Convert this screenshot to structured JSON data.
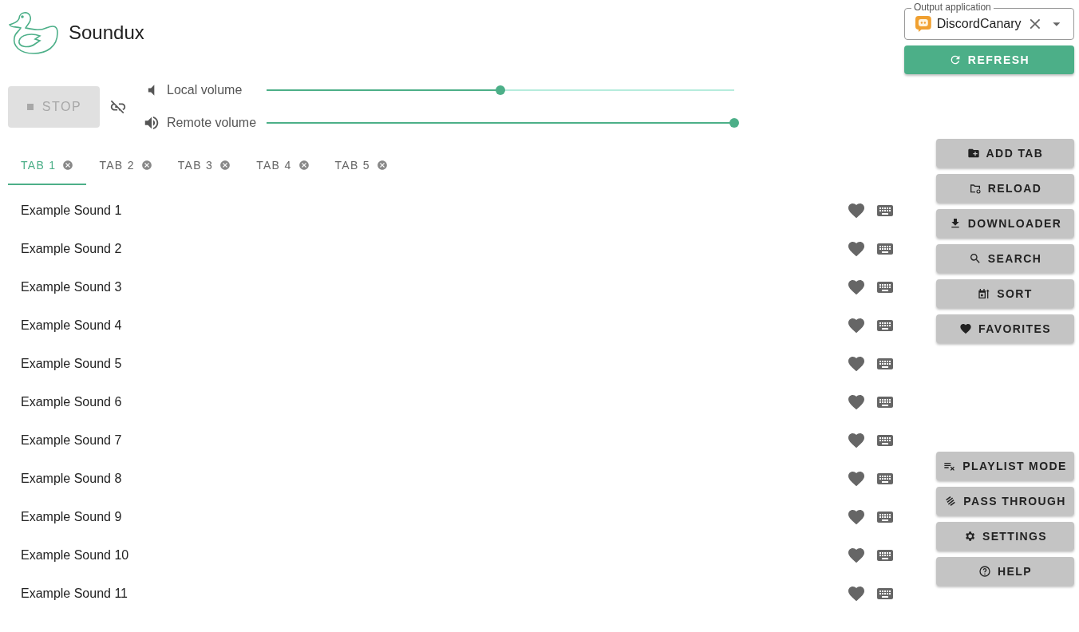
{
  "app": {
    "title": "Soundux"
  },
  "output": {
    "label": "Output application",
    "value": "DiscordCanary"
  },
  "refresh": {
    "label": "REFRESH"
  },
  "stop": {
    "label": "STOP",
    "disabled": true
  },
  "volumes": [
    {
      "name": "Local volume",
      "level": 0.5
    },
    {
      "name": "Remote volume",
      "level": 1.0
    }
  ],
  "tabs": [
    {
      "label": "TAB 1",
      "selected": true
    },
    {
      "label": "TAB 2",
      "selected": false
    },
    {
      "label": "TAB 3",
      "selected": false
    },
    {
      "label": "TAB 4",
      "selected": false
    },
    {
      "label": "TAB 5",
      "selected": false
    }
  ],
  "sounds": [
    "Example Sound 1",
    "Example Sound 2",
    "Example Sound 3",
    "Example Sound 4",
    "Example Sound 5",
    "Example Sound 6",
    "Example Sound 7",
    "Example Sound 8",
    "Example Sound 9",
    "Example Sound 10",
    "Example Sound 11"
  ],
  "actions_top": [
    "ADD TAB",
    "RELOAD",
    "DOWNLOADER",
    "SEARCH",
    "SORT",
    "FAVORITES"
  ],
  "actions_bottom": [
    "PLAYLIST MODE",
    "PASS THROUGH",
    "SETTINGS",
    "HELP"
  ]
}
